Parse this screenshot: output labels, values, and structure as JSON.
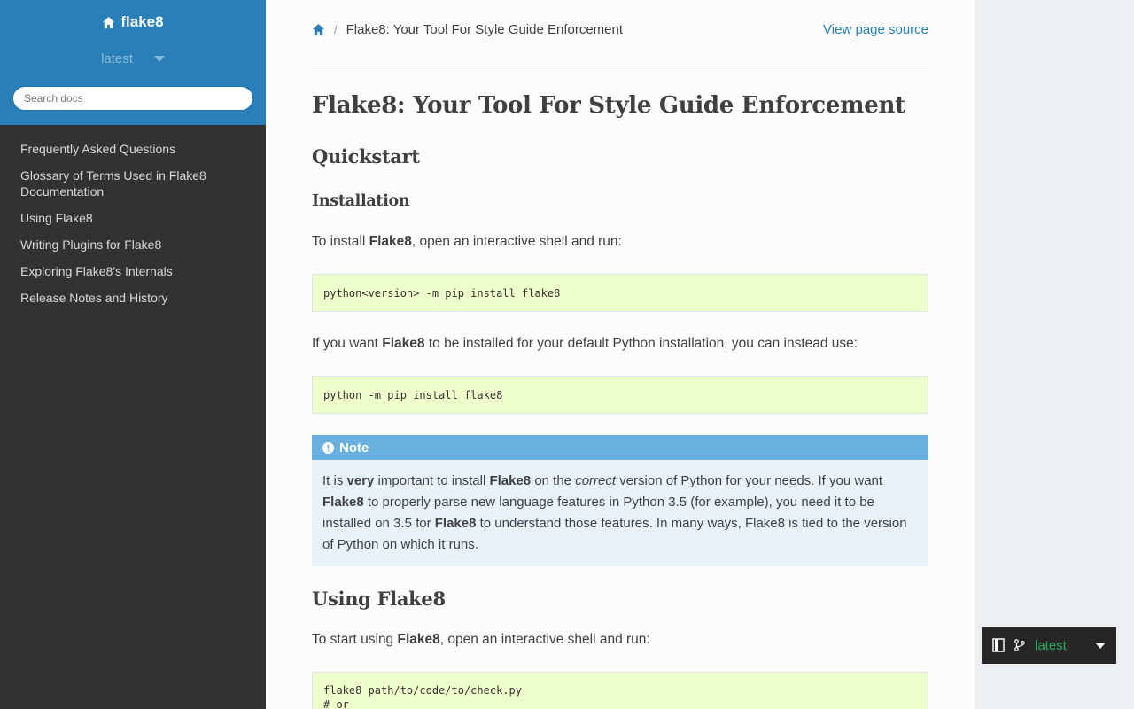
{
  "sidebar": {
    "brand": "flake8",
    "version": "latest",
    "search_placeholder": "Search docs",
    "nav": [
      "Frequently Asked Questions",
      "Glossary of Terms Used in Flake8 Documentation",
      "Using Flake8",
      "Writing Plugins for Flake8",
      "Exploring Flake8’s Internals",
      "Release Notes and History"
    ]
  },
  "breadcrumbs": {
    "separator": "/",
    "current": "Flake8: Your Tool For Style Guide Enforcement",
    "view_source": "View page source"
  },
  "content": {
    "title": "Flake8: Your Tool For Style Guide Enforcement",
    "quickstart": "Quickstart",
    "installation": "Installation",
    "install_intro": {
      "pre": "To install ",
      "bold": "Flake8",
      "post": ", open an interactive shell and run:"
    },
    "code1": "python<version> -m pip install flake8",
    "default_intro": {
      "pre": "If you want ",
      "bold": "Flake8",
      "post": " to be installed for your default Python installation, you can instead use:"
    },
    "code2": "python -m pip install flake8",
    "note": {
      "title": "Note",
      "t1": "It is ",
      "b1": "very",
      "t2": " important to install ",
      "b2": "Flake8",
      "t3": " on the ",
      "i1": "correct",
      "t4": " version of Python for your needs. If you want ",
      "b3": "Flake8",
      "t5": " to properly parse new language features in Python 3.5 (for example), you need it to be installed on 3.5 for ",
      "b4": "Flake8",
      "t6": " to understand those features. In many ways, Flake8 is tied to the version of Python on which it runs."
    },
    "using": "Using Flake8",
    "using_intro": {
      "pre": "To start using ",
      "bold": "Flake8",
      "post": ", open an interactive shell and run:"
    },
    "code3_line1": "flake8 path/to/code/to/check.py",
    "code3_line2": "# or"
  },
  "rtd": {
    "version": "latest"
  }
}
